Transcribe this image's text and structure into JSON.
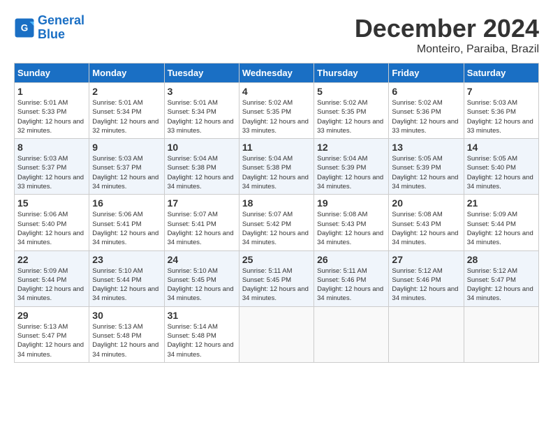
{
  "app": {
    "name": "GeneralBlue"
  },
  "calendar": {
    "month": "December 2024",
    "location": "Monteiro, Paraiba, Brazil",
    "days_of_week": [
      "Sunday",
      "Monday",
      "Tuesday",
      "Wednesday",
      "Thursday",
      "Friday",
      "Saturday"
    ],
    "weeks": [
      [
        {
          "day": "1",
          "sunrise": "Sunrise: 5:01 AM",
          "sunset": "Sunset: 5:33 PM",
          "daylight": "Daylight: 12 hours and 32 minutes."
        },
        {
          "day": "2",
          "sunrise": "Sunrise: 5:01 AM",
          "sunset": "Sunset: 5:34 PM",
          "daylight": "Daylight: 12 hours and 32 minutes."
        },
        {
          "day": "3",
          "sunrise": "Sunrise: 5:01 AM",
          "sunset": "Sunset: 5:34 PM",
          "daylight": "Daylight: 12 hours and 33 minutes."
        },
        {
          "day": "4",
          "sunrise": "Sunrise: 5:02 AM",
          "sunset": "Sunset: 5:35 PM",
          "daylight": "Daylight: 12 hours and 33 minutes."
        },
        {
          "day": "5",
          "sunrise": "Sunrise: 5:02 AM",
          "sunset": "Sunset: 5:35 PM",
          "daylight": "Daylight: 12 hours and 33 minutes."
        },
        {
          "day": "6",
          "sunrise": "Sunrise: 5:02 AM",
          "sunset": "Sunset: 5:36 PM",
          "daylight": "Daylight: 12 hours and 33 minutes."
        },
        {
          "day": "7",
          "sunrise": "Sunrise: 5:03 AM",
          "sunset": "Sunset: 5:36 PM",
          "daylight": "Daylight: 12 hours and 33 minutes."
        }
      ],
      [
        {
          "day": "8",
          "sunrise": "Sunrise: 5:03 AM",
          "sunset": "Sunset: 5:37 PM",
          "daylight": "Daylight: 12 hours and 33 minutes."
        },
        {
          "day": "9",
          "sunrise": "Sunrise: 5:03 AM",
          "sunset": "Sunset: 5:37 PM",
          "daylight": "Daylight: 12 hours and 34 minutes."
        },
        {
          "day": "10",
          "sunrise": "Sunrise: 5:04 AM",
          "sunset": "Sunset: 5:38 PM",
          "daylight": "Daylight: 12 hours and 34 minutes."
        },
        {
          "day": "11",
          "sunrise": "Sunrise: 5:04 AM",
          "sunset": "Sunset: 5:38 PM",
          "daylight": "Daylight: 12 hours and 34 minutes."
        },
        {
          "day": "12",
          "sunrise": "Sunrise: 5:04 AM",
          "sunset": "Sunset: 5:39 PM",
          "daylight": "Daylight: 12 hours and 34 minutes."
        },
        {
          "day": "13",
          "sunrise": "Sunrise: 5:05 AM",
          "sunset": "Sunset: 5:39 PM",
          "daylight": "Daylight: 12 hours and 34 minutes."
        },
        {
          "day": "14",
          "sunrise": "Sunrise: 5:05 AM",
          "sunset": "Sunset: 5:40 PM",
          "daylight": "Daylight: 12 hours and 34 minutes."
        }
      ],
      [
        {
          "day": "15",
          "sunrise": "Sunrise: 5:06 AM",
          "sunset": "Sunset: 5:40 PM",
          "daylight": "Daylight: 12 hours and 34 minutes."
        },
        {
          "day": "16",
          "sunrise": "Sunrise: 5:06 AM",
          "sunset": "Sunset: 5:41 PM",
          "daylight": "Daylight: 12 hours and 34 minutes."
        },
        {
          "day": "17",
          "sunrise": "Sunrise: 5:07 AM",
          "sunset": "Sunset: 5:41 PM",
          "daylight": "Daylight: 12 hours and 34 minutes."
        },
        {
          "day": "18",
          "sunrise": "Sunrise: 5:07 AM",
          "sunset": "Sunset: 5:42 PM",
          "daylight": "Daylight: 12 hours and 34 minutes."
        },
        {
          "day": "19",
          "sunrise": "Sunrise: 5:08 AM",
          "sunset": "Sunset: 5:43 PM",
          "daylight": "Daylight: 12 hours and 34 minutes."
        },
        {
          "day": "20",
          "sunrise": "Sunrise: 5:08 AM",
          "sunset": "Sunset: 5:43 PM",
          "daylight": "Daylight: 12 hours and 34 minutes."
        },
        {
          "day": "21",
          "sunrise": "Sunrise: 5:09 AM",
          "sunset": "Sunset: 5:44 PM",
          "daylight": "Daylight: 12 hours and 34 minutes."
        }
      ],
      [
        {
          "day": "22",
          "sunrise": "Sunrise: 5:09 AM",
          "sunset": "Sunset: 5:44 PM",
          "daylight": "Daylight: 12 hours and 34 minutes."
        },
        {
          "day": "23",
          "sunrise": "Sunrise: 5:10 AM",
          "sunset": "Sunset: 5:44 PM",
          "daylight": "Daylight: 12 hours and 34 minutes."
        },
        {
          "day": "24",
          "sunrise": "Sunrise: 5:10 AM",
          "sunset": "Sunset: 5:45 PM",
          "daylight": "Daylight: 12 hours and 34 minutes."
        },
        {
          "day": "25",
          "sunrise": "Sunrise: 5:11 AM",
          "sunset": "Sunset: 5:45 PM",
          "daylight": "Daylight: 12 hours and 34 minutes."
        },
        {
          "day": "26",
          "sunrise": "Sunrise: 5:11 AM",
          "sunset": "Sunset: 5:46 PM",
          "daylight": "Daylight: 12 hours and 34 minutes."
        },
        {
          "day": "27",
          "sunrise": "Sunrise: 5:12 AM",
          "sunset": "Sunset: 5:46 PM",
          "daylight": "Daylight: 12 hours and 34 minutes."
        },
        {
          "day": "28",
          "sunrise": "Sunrise: 5:12 AM",
          "sunset": "Sunset: 5:47 PM",
          "daylight": "Daylight: 12 hours and 34 minutes."
        }
      ],
      [
        {
          "day": "29",
          "sunrise": "Sunrise: 5:13 AM",
          "sunset": "Sunset: 5:47 PM",
          "daylight": "Daylight: 12 hours and 34 minutes."
        },
        {
          "day": "30",
          "sunrise": "Sunrise: 5:13 AM",
          "sunset": "Sunset: 5:48 PM",
          "daylight": "Daylight: 12 hours and 34 minutes."
        },
        {
          "day": "31",
          "sunrise": "Sunrise: 5:14 AM",
          "sunset": "Sunset: 5:48 PM",
          "daylight": "Daylight: 12 hours and 34 minutes."
        },
        null,
        null,
        null,
        null
      ]
    ]
  }
}
